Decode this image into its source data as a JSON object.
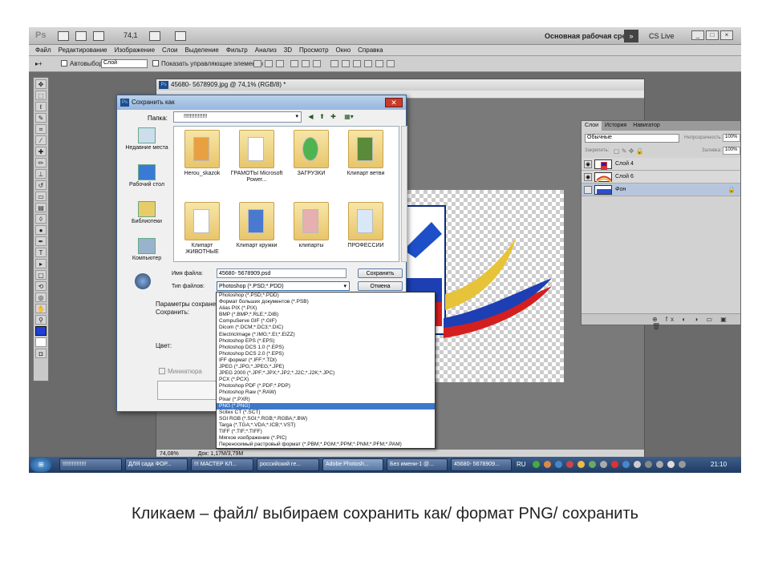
{
  "app": {
    "logo": "Ps",
    "zoom": "74,1",
    "workspace": "Основная рабочая среда",
    "cslive": "CS Live"
  },
  "menu": [
    "Файл",
    "Редактирование",
    "Изображение",
    "Слои",
    "Выделение",
    "Фильтр",
    "Анализ",
    "3D",
    "Просмотр",
    "Окно",
    "Справка"
  ],
  "options": {
    "autoselect_label": "Автовыбор:",
    "autoselect_value": "Слой",
    "show_controls_label": "Показать управляющие элементы"
  },
  "document": {
    "title": "45680- 5678909.jpg @ 74,1% (RGB/8) *",
    "zoom_status": "74,08%",
    "doc_status": "Док: 1,17M/3,79M"
  },
  "layers": {
    "tabs": [
      "Слои",
      "История",
      "Навигатор"
    ],
    "blend_mode": "Обычные",
    "opacity_label": "Непрозрачность:",
    "opacity_value": "100%",
    "lock_label": "Закрепить:",
    "fill_label": "Заливка:",
    "fill_value": "100%",
    "items": [
      {
        "name": "Слой 4"
      },
      {
        "name": "Слой 6"
      },
      {
        "name": "Фон"
      }
    ]
  },
  "dialog": {
    "title": "Сохранить как",
    "folder_label": "Папка:",
    "folder_value": "!!!!!!!!!!!!!!!",
    "places": [
      "Недавние места",
      "Рабочий стол",
      "Библиотеки",
      "Компьютер"
    ],
    "files": [
      "Herou_skazok",
      "ГРАМОТЫ Microsoft Power...",
      "ЗАГРУЗКИ",
      "Клипарт ветви",
      "Клипарт ЖИВОТНЫЕ",
      "Клипарт кружки",
      "клипарты",
      "ПРОФЕССИИ"
    ],
    "filename_label": "Имя файла:",
    "filename_value": "45680- 5678909.psd",
    "filetype_label": "Тип файлов:",
    "filetype_value": "Photoshop (*.PSD;*.PDD)",
    "save_button": "Сохранить",
    "cancel_button": "Отмена",
    "params_label": "Параметры сохранения",
    "save_label": "Сохранить:",
    "color_label": "Цвет:",
    "thumbnail_label": "Миниатюра"
  },
  "formats": [
    "Photoshop (*.PSD;*.PDD)",
    "Формат больших документов (*.PSB)",
    "Alias PIX (*.PIX)",
    "BMP (*.BMP;*.RLE;*.DIB)",
    "CompuServe GIF (*.GIF)",
    "Dicom (*.DCM;*.DC3;*.DIC)",
    "ElectricImage (*.IMG;*.EI;*.EIZZ)",
    "Photoshop EPS (*.EPS)",
    "Photoshop DCS 1.0 (*.EPS)",
    "Photoshop DCS 2.0 (*.EPS)",
    "IFF формат (*.IFF;*.TDI)",
    "JPEG (*.JPG;*.JPEG;*.JPE)",
    "JPEG 2000 (*.JPF;*.JPX;*.JP2;*.J2C;*.J2K;*.JPC)",
    "PCX (*.PCX)",
    "Photoshop PDF (*.PDF;*.PDP)",
    "Photoshop Raw (*.RAW)",
    "Pixar (*.PXR)",
    "PNG (*.PNG)",
    "Scitex CT (*.SCT)",
    "SGI RGB (*.SGI;*.RGB;*.RGBA;*.BW)",
    "Targa (*.TGA;*.VDA;*.ICB;*.VST)",
    "TIFF (*.TIF;*.TIFF)",
    "Мягкое изображение (*.PIC)",
    "Переносимый растровый формат (*.PBM;*.PGM;*.PPM;*.PNM;*.PFM;*.PAM)"
  ],
  "selected_format_index": 17,
  "taskbar": {
    "items": [
      "!!!!!!!!!!!!!!!",
      "ДЛЯ сада ФОР...",
      "!!! МАСТЕР КЛ...",
      "российский ге...",
      "Adobe Photosh...",
      "Без имени-1 @...",
      "45680- 5678909..."
    ],
    "language": "RU",
    "clock": "21:10"
  },
  "caption": "Кликаем – файл/ выбираем сохранить как/ формат PNG/ сохранить"
}
